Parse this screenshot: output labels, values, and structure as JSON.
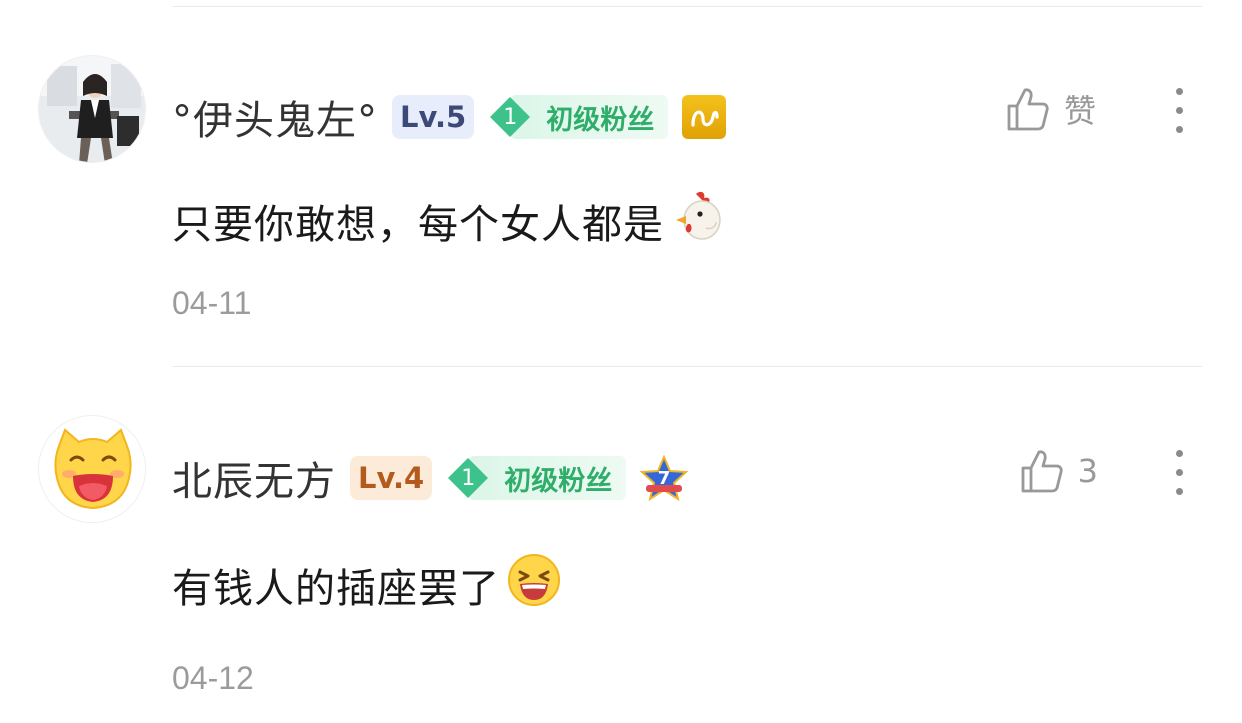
{
  "comments": [
    {
      "username": "°伊头鬼左°",
      "level": "Lv.5",
      "fan_level": "1",
      "fan_label": "初级粉丝",
      "like_label": "赞",
      "text": "只要你敢想，每个女人都是",
      "date": "04-11",
      "colors": {
        "level_bg": "#e8edfb",
        "level_fg": "#3d4a78"
      },
      "extra_badge": "gold-badge-icon",
      "emoji": "chicken-icon"
    },
    {
      "username": "北辰无方",
      "level": "Lv.4",
      "fan_level": "1",
      "fan_label": "初级粉丝",
      "like_label": "3",
      "text": "有钱人的插座罢了",
      "date": "04-12",
      "colors": {
        "level_bg": "#fdebd9",
        "level_fg": "#b45a1c"
      },
      "extra_badge": "star-7-badge-icon",
      "extra_badge_text": "7",
      "emoji": "laughing-face-icon"
    }
  ],
  "colors": {
    "fan_green": "#2fae6a",
    "divider": "#ebebeb",
    "meta_gray": "#9b9b9b"
  }
}
